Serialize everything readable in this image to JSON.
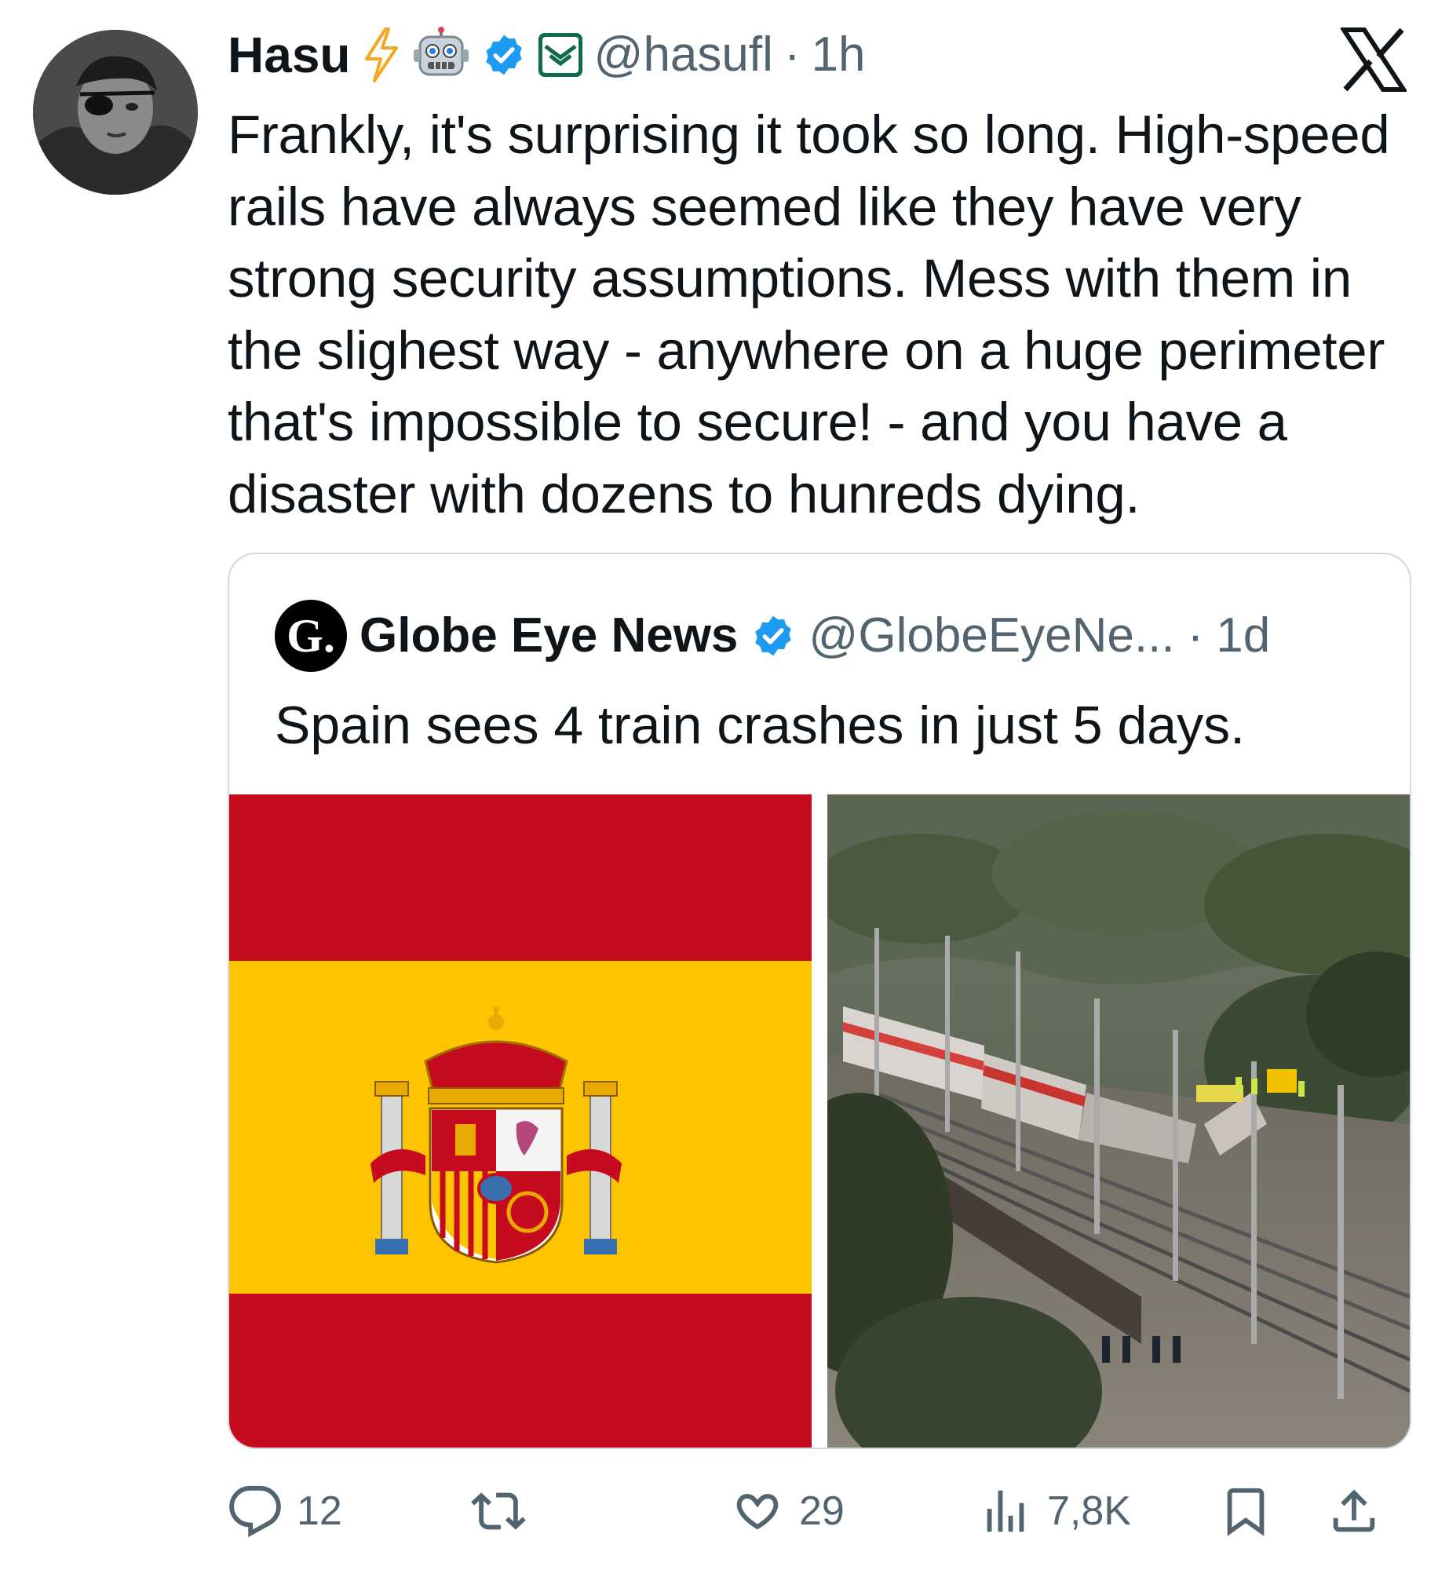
{
  "tweet": {
    "author": {
      "display_name": "Hasu",
      "handle": "@hasufl",
      "time": "1h",
      "separator": "·",
      "badges": [
        "lightning-emoji",
        "robot-emoji",
        "verified-badge",
        "affiliation-badge"
      ],
      "avatar": "avatar-illustration-eyepatch"
    },
    "text": "Frankly, it's surprising it took so long. High-speed rails have always seemed like they have very strong security assumptions. Mess with them in the slighest way - anywhere on a huge perimeter that's impossible to secure! - and you have a disaster with dozens to hunreds dying.",
    "platform_icon": "x-logo-icon"
  },
  "quote": {
    "author": {
      "display_name": "Globe Eye News",
      "handle": "@GlobeEyeNe...",
      "time": "1d",
      "separator": "·",
      "avatar_letter": "G.",
      "verified": true
    },
    "text": "Spain sees 4 train crashes in just 5 days.",
    "media": [
      {
        "type": "image",
        "name": "spain-flag",
        "colors": {
          "red": "#c60b1e",
          "yellow": "#ffc400"
        }
      },
      {
        "type": "image",
        "name": "train-crash-photo"
      }
    ]
  },
  "actions": {
    "reply_count": "12",
    "retweet_count": "",
    "like_count": "29",
    "views_count": "7,8K"
  },
  "colors": {
    "text_primary": "#0f1419",
    "text_secondary": "#536471",
    "verified_blue": "#1d9bf0",
    "border": "#cfd9de"
  }
}
